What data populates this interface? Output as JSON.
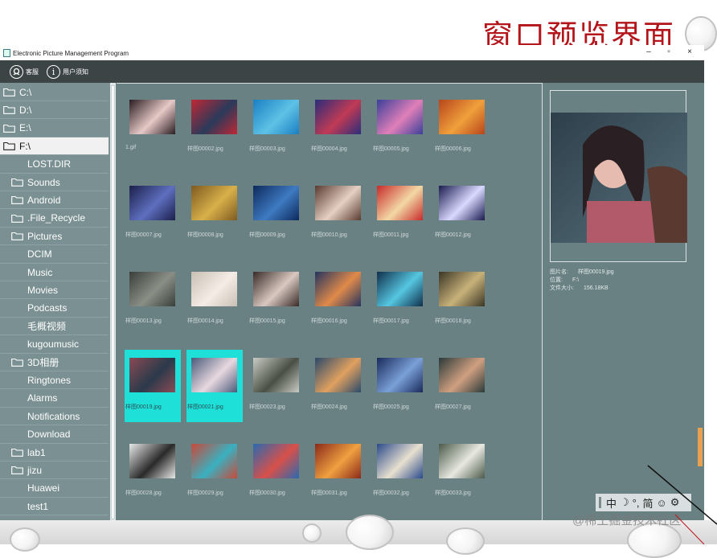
{
  "slide": {
    "title": "窗口预览界面",
    "watermark": "@稀土掘金技术社区"
  },
  "window": {
    "title": "Electronic Picture Management Program",
    "controls": {
      "minimize": "–",
      "restore": "▫",
      "close": "×"
    }
  },
  "toolbar": {
    "customer_service": "客服",
    "user_notice": "用户须知",
    "info_glyph": "i"
  },
  "sidebar": {
    "items": [
      {
        "label": "C:\\",
        "icon": "folder-icon",
        "selected": false
      },
      {
        "label": "D:\\",
        "icon": "folder-icon",
        "selected": false
      },
      {
        "label": "E:\\",
        "icon": "folder-icon",
        "selected": false
      },
      {
        "label": "F:\\",
        "icon": "folder-icon",
        "selected": true
      },
      {
        "label": "LOST.DIR",
        "icon": "",
        "selected": false
      },
      {
        "label": "Sounds",
        "icon": "folder-icon",
        "selected": false
      },
      {
        "label": "Android",
        "icon": "folder-icon",
        "selected": false
      },
      {
        "label": ".File_Recycle",
        "icon": "folder-icon",
        "selected": false
      },
      {
        "label": "Pictures",
        "icon": "folder-icon",
        "selected": false
      },
      {
        "label": "DCIM",
        "icon": "",
        "selected": false
      },
      {
        "label": "Music",
        "icon": "",
        "selected": false
      },
      {
        "label": "Movies",
        "icon": "",
        "selected": false
      },
      {
        "label": "Podcasts",
        "icon": "",
        "selected": false
      },
      {
        "label": "毛概视频",
        "icon": "",
        "selected": false
      },
      {
        "label": "kugoumusic",
        "icon": "",
        "selected": false
      },
      {
        "label": "3D相册",
        "icon": "folder-icon",
        "selected": false
      },
      {
        "label": "Ringtones",
        "icon": "",
        "selected": false
      },
      {
        "label": "Alarms",
        "icon": "",
        "selected": false
      },
      {
        "label": "Notifications",
        "icon": "",
        "selected": false
      },
      {
        "label": "Download",
        "icon": "",
        "selected": false
      },
      {
        "label": "lab1",
        "icon": "folder-icon",
        "selected": false
      },
      {
        "label": "jizu",
        "icon": "folder-icon",
        "selected": false
      },
      {
        "label": "Huawei",
        "icon": "",
        "selected": false
      },
      {
        "label": "test1",
        "icon": "",
        "selected": false
      }
    ]
  },
  "grid": {
    "thumbnails": [
      {
        "name": "1.gif",
        "colors": [
          "#2a1d22",
          "#e7c9c7"
        ],
        "selected": false
      },
      {
        "name": "样图00002.jpg",
        "colors": [
          "#c02735",
          "#2a3a5a"
        ],
        "selected": false
      },
      {
        "name": "样图00003.jpg",
        "colors": [
          "#1a7fc2",
          "#5ec2e6"
        ],
        "selected": false
      },
      {
        "name": "样图00004.jpg",
        "colors": [
          "#2b2d7a",
          "#c03a55"
        ],
        "selected": false
      },
      {
        "name": "样图00005.jpg",
        "colors": [
          "#3b3f9a",
          "#e07fb8"
        ],
        "selected": false
      },
      {
        "name": "样图00006.jpg",
        "colors": [
          "#b8451b",
          "#f0a03c"
        ],
        "selected": false
      },
      {
        "name": "样图00007.jpg",
        "colors": [
          "#1b1f4a",
          "#5e6fbf"
        ],
        "selected": false
      },
      {
        "name": "样图00008.jpg",
        "colors": [
          "#7e5a20",
          "#d8b04a"
        ],
        "selected": false
      },
      {
        "name": "样图00009.jpg",
        "colors": [
          "#0e2a5c",
          "#3e7ac2"
        ],
        "selected": false
      },
      {
        "name": "样图00010.jpg",
        "colors": [
          "#5a3a30",
          "#e5d0c4"
        ],
        "selected": false
      },
      {
        "name": "样图00011.jpg",
        "colors": [
          "#c72a2a",
          "#f3d8a5"
        ],
        "selected": false
      },
      {
        "name": "样图00012.jpg",
        "colors": [
          "#1a1a4e",
          "#d9d9ff"
        ],
        "selected": false
      },
      {
        "name": "样图00013.jpg",
        "colors": [
          "#3a3e3a",
          "#8a8f86"
        ],
        "selected": false
      },
      {
        "name": "样图00014.jpg",
        "colors": [
          "#c8c0b4",
          "#f5ece6"
        ],
        "selected": false
      },
      {
        "name": "样图00015.jpg",
        "colors": [
          "#3a2a28",
          "#d8c8c0"
        ],
        "selected": false
      },
      {
        "name": "样图00016.jpg",
        "colors": [
          "#25345e",
          "#e08a4a"
        ],
        "selected": false
      },
      {
        "name": "样图00017.jpg",
        "colors": [
          "#0f2e4a",
          "#56c6e0"
        ],
        "selected": false
      },
      {
        "name": "样图00018.jpg",
        "colors": [
          "#3a3526",
          "#c8b27a"
        ],
        "selected": false
      },
      {
        "name": "样图00019.jpg",
        "colors": [
          "#8a4a55",
          "#2a3a4a"
        ],
        "selected": true
      },
      {
        "name": "样图00021.jpg",
        "colors": [
          "#4a5a7a",
          "#e8d8e0"
        ],
        "selected": true
      },
      {
        "name": "样图00023.jpg",
        "colors": [
          "#c8ccc4",
          "#4a4f45"
        ],
        "selected": false
      },
      {
        "name": "样图00024.jpg",
        "colors": [
          "#2a4a6a",
          "#e0a060"
        ],
        "selected": false
      },
      {
        "name": "样图00025.jpg",
        "colors": [
          "#1a2a5a",
          "#7aa0d8"
        ],
        "selected": false
      },
      {
        "name": "样图00027.jpg",
        "colors": [
          "#2a3a3a",
          "#d0a080"
        ],
        "selected": false
      },
      {
        "name": "样图00028.jpg",
        "colors": [
          "#e8e8e8",
          "#2a2a2a"
        ],
        "selected": false
      },
      {
        "name": "样图00029.jpg",
        "colors": [
          "#c84a3a",
          "#3ab0c0"
        ],
        "selected": false
      },
      {
        "name": "样图00030.jpg",
        "colors": [
          "#2a6ab0",
          "#d8504a"
        ],
        "selected": false
      },
      {
        "name": "样图00031.jpg",
        "colors": [
          "#8a2a1a",
          "#f0a040"
        ],
        "selected": false
      },
      {
        "name": "样图00032.jpg",
        "colors": [
          "#2a4a8a",
          "#e8e0d0"
        ],
        "selected": false
      },
      {
        "name": "样图00033.jpg",
        "colors": [
          "#4a5a4a",
          "#e8e8e0"
        ],
        "selected": false
      }
    ]
  },
  "preview": {
    "colors": [
      "#2e3f4a",
      "#e7bcb0"
    ],
    "info": [
      {
        "label": "图片名:",
        "value": "样图00019.jpg"
      },
      {
        "label": "位置:",
        "value": "F:\\"
      },
      {
        "label": "文件大小:",
        "value": "156.18KB"
      }
    ]
  },
  "ime": {
    "items": [
      "中",
      "☽",
      "°,",
      "简",
      "☺",
      "⚙"
    ]
  },
  "colors": {
    "slide_title": "#b3151b",
    "selection": "#1ee0d8",
    "app_bg": "#6a8183",
    "sidebar_bg": "#7b9092",
    "toolbar_bg": "#3d4446"
  }
}
